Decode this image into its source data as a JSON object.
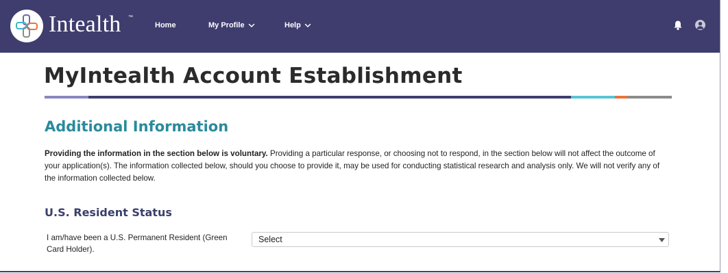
{
  "header": {
    "brand": "Intealth",
    "trademark": "™",
    "nav": {
      "home": "Home",
      "my_profile": "My Profile",
      "help": "Help"
    },
    "icons": {
      "logo": "intealth-logo-icon",
      "notifications": "bell-icon",
      "user": "user-avatar-icon",
      "dropdown": "chevron-down-icon"
    }
  },
  "main": {
    "page_title": "MyIntealth Account Establishment",
    "section_title": "Additional Information",
    "intro_bold": "Providing the information in the section below is voluntary.",
    "intro_text": " Providing a particular response, or choosing not to respond, in the section below will not affect the outcome of your application(s). The information collected below, should you choose to provide it, may be used for conducting statistical research and analysis only. We will not verify any of the information collected below.",
    "subsection_title": "U.S. Resident Status",
    "permanent_resident": {
      "label": "I am/have been a U.S. Permanent Resident (Green Card Holder).",
      "value": "Select"
    }
  },
  "colors": {
    "nav_background": "#3f3d6e",
    "page_title": "#2b2b2b",
    "section_title": "#2a8a9c",
    "subsection_title": "#3a3f6b",
    "rule_segments": [
      "#8a86c0",
      "#3f3d6e",
      "#5bc4d4",
      "#e8743b",
      "#8c8c8c"
    ]
  }
}
